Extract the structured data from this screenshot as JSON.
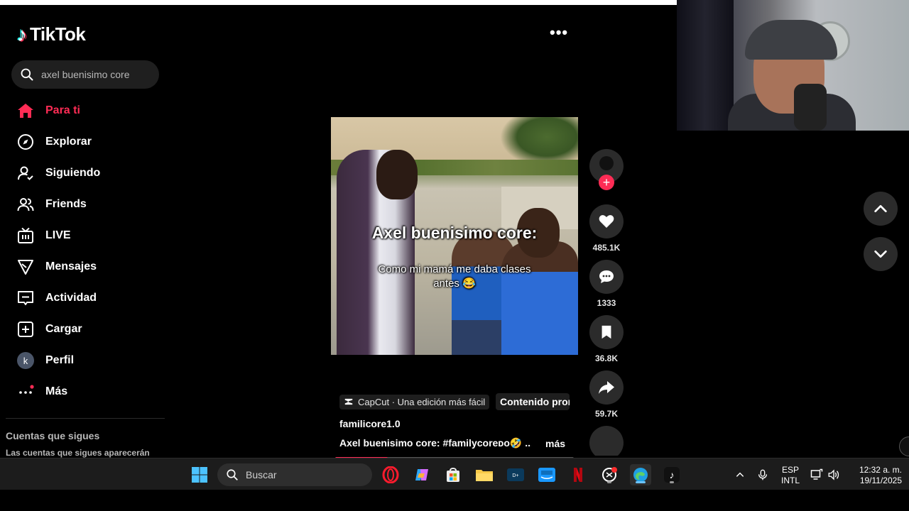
{
  "app": {
    "name": "TikTok"
  },
  "search": {
    "value": "axel buenisimo core"
  },
  "sidebar": {
    "items": [
      {
        "label": "Para ti",
        "icon": "home-icon",
        "active": true
      },
      {
        "label": "Explorar",
        "icon": "compass-icon"
      },
      {
        "label": "Siguiendo",
        "icon": "user-follow-icon"
      },
      {
        "label": "Friends",
        "icon": "friends-icon"
      },
      {
        "label": "LIVE",
        "icon": "live-tv-icon"
      },
      {
        "label": "Mensajes",
        "icon": "send-icon"
      },
      {
        "label": "Actividad",
        "icon": "activity-icon"
      },
      {
        "label": "Cargar",
        "icon": "upload-plus-icon"
      },
      {
        "label": "Perfil",
        "icon": "avatar",
        "avatar_letter": "k"
      },
      {
        "label": "Más",
        "icon": "more-icon"
      }
    ],
    "following_title": "Cuentas que sigues",
    "following_sub": "Las cuentas que sigues aparecerán"
  },
  "video": {
    "overlay_title": "Axel buenisimo core:",
    "overlay_sub": "Como mi mamá me daba clases antes 😂",
    "capcut_label": "CapCut · Una edición más fácil",
    "content_label": "Contenido promocional",
    "author": "familicore1.0",
    "description": "Axel buenisimo core: #familycoreᴅᴏ🤣 ...",
    "more_label": "más",
    "progress_fraction": 0.22
  },
  "actions": {
    "likes": "485.1K",
    "comments": "1333",
    "saves": "36.8K",
    "shares": "59.7K"
  },
  "taskbar": {
    "search_placeholder": "Buscar",
    "lang_top": "ESP",
    "lang_bottom": "INTL",
    "time": "12:32 a. m.",
    "date": "19/11/2025"
  },
  "colors": {
    "accent": "#fe2c55",
    "background": "#000000",
    "panel": "#2b2b2b"
  }
}
